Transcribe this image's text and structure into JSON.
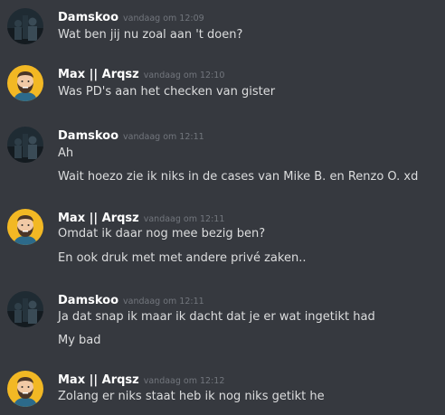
{
  "messages": [
    {
      "author": "Damskoo",
      "avatar": "dark-avatar",
      "time": "vandaag om 12:09",
      "lines": [
        "Wat ben jij nu zoal aan 't doen?"
      ]
    },
    {
      "author": "Max || Arqsz",
      "avatar": "bearded-man-avatar",
      "time": "vandaag om 12:10",
      "lines": [
        "Was PD's aan het checken van gister"
      ]
    },
    {
      "author": "Damskoo",
      "avatar": "dark-avatar",
      "time": "vandaag om 12:11",
      "lines": [
        "Ah",
        "Wait hoezo zie ik niks in de cases van Mike B. en Renzo O. xd"
      ]
    },
    {
      "author": "Max || Arqsz",
      "avatar": "bearded-man-avatar",
      "time": "vandaag om 12:11",
      "lines": [
        "Omdat ik daar nog mee bezig ben?",
        "En ook druk met met andere privé zaken.."
      ]
    },
    {
      "author": "Damskoo",
      "avatar": "dark-avatar",
      "time": "vandaag om 12:11",
      "lines": [
        "Ja dat snap ik maar ik dacht dat je er wat ingetikt had",
        "My bad"
      ]
    },
    {
      "author": "Max || Arqsz",
      "avatar": "bearded-man-avatar",
      "time": "vandaag om 12:12",
      "lines": [
        "Zolang er niks staat heb ik nog niks getikt he"
      ]
    }
  ],
  "colors": {
    "background": "#36393f",
    "username": "#ffffff",
    "timestamp": "#72767d",
    "text": "#dcddde",
    "avatar_yellow": "#f2b824"
  }
}
